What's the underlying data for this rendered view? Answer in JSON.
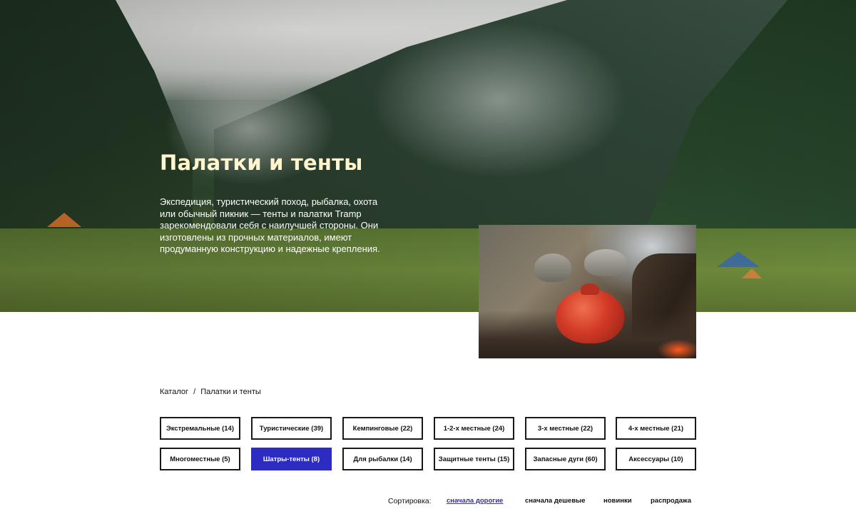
{
  "hero": {
    "title": "Палатки и тенты",
    "description": "Экспедиция, туристический поход, рыбалка, охота или обычный пикник — тенты и палатки Tramp зарекомендовали себя с наилучшей стороны. Они изготовлены из прочных материалов, имеют продуманную конструкцию и надежные крепления."
  },
  "breadcrumb": {
    "root": "Каталог",
    "separator": "/",
    "current": "Палатки и тенты"
  },
  "categories": [
    {
      "label": "Экстремальные (14)",
      "active": false
    },
    {
      "label": "Туристические (39)",
      "active": false
    },
    {
      "label": "Кемпинговые (22)",
      "active": false
    },
    {
      "label": "1-2-х местные (24)",
      "active": false
    },
    {
      "label": "3-х местные (22)",
      "active": false
    },
    {
      "label": "4-х местные (21)",
      "active": false
    },
    {
      "label": "Многоместные (5)",
      "active": false
    },
    {
      "label": "Шатры-тенты (8)",
      "active": true
    },
    {
      "label": "Для рыбалки (14)",
      "active": false
    },
    {
      "label": "Защитные тенты (15)",
      "active": false
    },
    {
      "label": "Запасные дуги (60)",
      "active": false
    },
    {
      "label": "Аксессуары (10)",
      "active": false
    }
  ],
  "sort": {
    "label": "Сортировка:",
    "options": [
      "сначала дорогие",
      "сначала дешевые",
      "новинки",
      "распродажа"
    ],
    "active_index": 0
  },
  "colors": {
    "accent": "#2c2bc2",
    "hero_title": "#fff6d0",
    "border": "#1a1a1a"
  }
}
